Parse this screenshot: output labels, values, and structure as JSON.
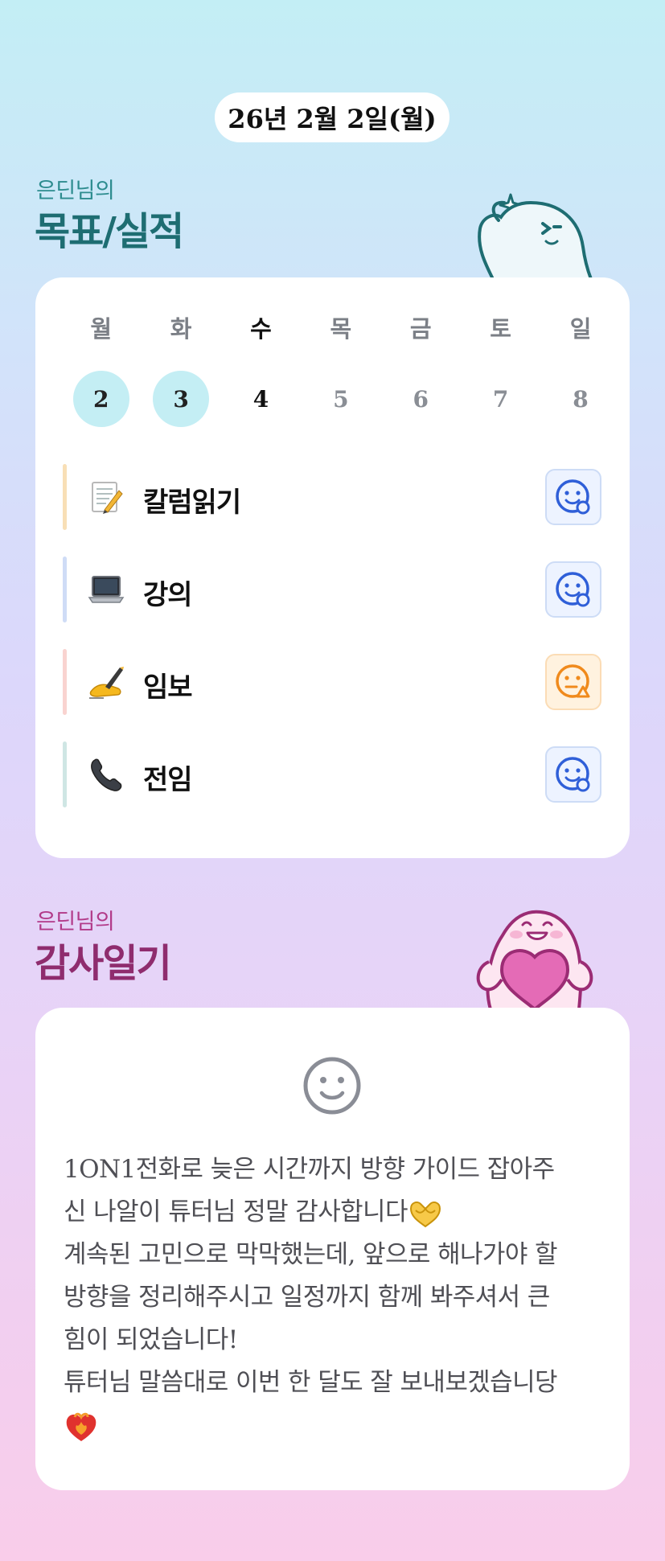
{
  "header": {
    "date": "26년 2월 2일(월)"
  },
  "goals_section": {
    "subtitle": "은딘님의",
    "title": "목표/실적",
    "weekdays": [
      "월",
      "화",
      "수",
      "목",
      "금",
      "토",
      "일"
    ],
    "dates": [
      "2",
      "3",
      "4",
      "5",
      "6",
      "7",
      "8"
    ],
    "items": [
      {
        "emoji": "memo",
        "label": "칼럼읽기",
        "status": "smile-blue",
        "bar_color": "#f8dfb6"
      },
      {
        "emoji": "laptop",
        "label": "강의",
        "status": "smile-blue",
        "bar_color": "#cfdcf6"
      },
      {
        "emoji": "writing-hand",
        "label": "임보",
        "status": "meh-orange",
        "bar_color": "#f9d3d0"
      },
      {
        "emoji": "telephone",
        "label": "전임",
        "status": "smile-blue",
        "bar_color": "#cfe6e4"
      }
    ]
  },
  "diary_section": {
    "subtitle": "은딘님의",
    "title": "감사일기",
    "face_icon": "smile-outline-icon",
    "lines": [
      "1ON1전화로 늦은 시간까지 방향 가이드 잡아주",
      "신 나알이 튜터님 정말 감사합니다",
      "계속된 고민으로 막막했는데, 앞으로 해나가야 할",
      "방향을 정리해주시고 일정까지 함께 봐주셔서 큰",
      "힘이 되었습니다!",
      "튜터님 말씀대로 이번 한 달도 잘 보내보겠습니당"
    ]
  },
  "colors": {
    "teal_accent": "#1e6d72",
    "plum_accent": "#8f2c6e",
    "done_circle": "#c4eef4",
    "status_blue": "#2f5fd8",
    "status_orange": "#f08a1c"
  }
}
